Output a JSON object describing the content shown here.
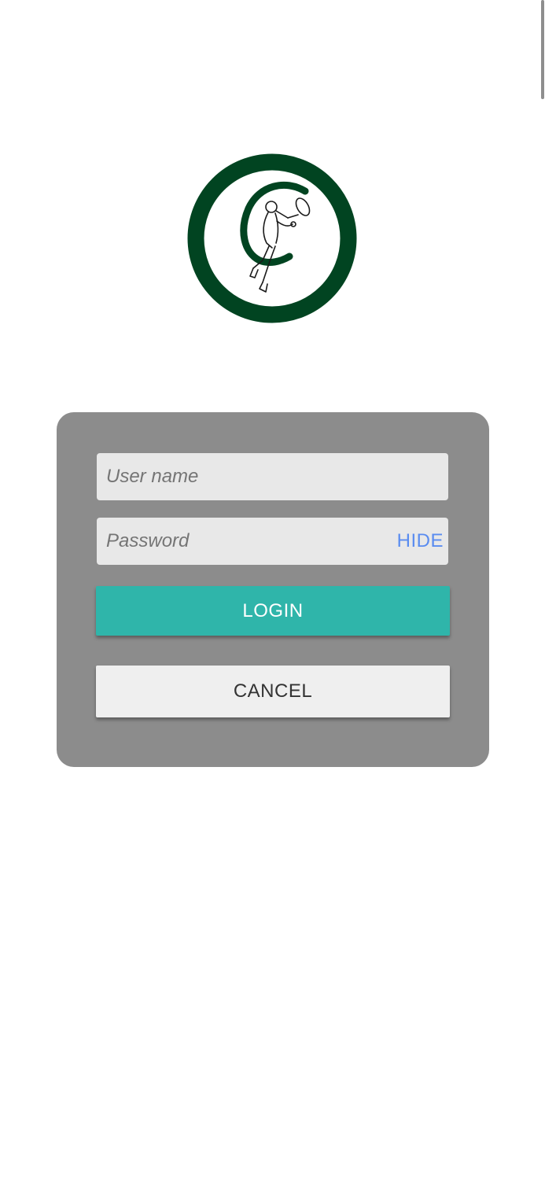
{
  "login_form": {
    "username_placeholder": "User name",
    "username_value": "",
    "password_placeholder": "Password",
    "password_value": "",
    "password_toggle_label": "HIDE",
    "login_label": "LOGIN",
    "cancel_label": "CANCEL"
  },
  "colors": {
    "logo_ring": "#014421",
    "card_background": "#8c8c8c",
    "field_background": "#e8e8e8",
    "login_button": "#2fb5aa",
    "cancel_button": "#efefef",
    "toggle_text": "#5a8cf0"
  },
  "icons": {
    "logo": "tennis-club-logo-icon"
  }
}
